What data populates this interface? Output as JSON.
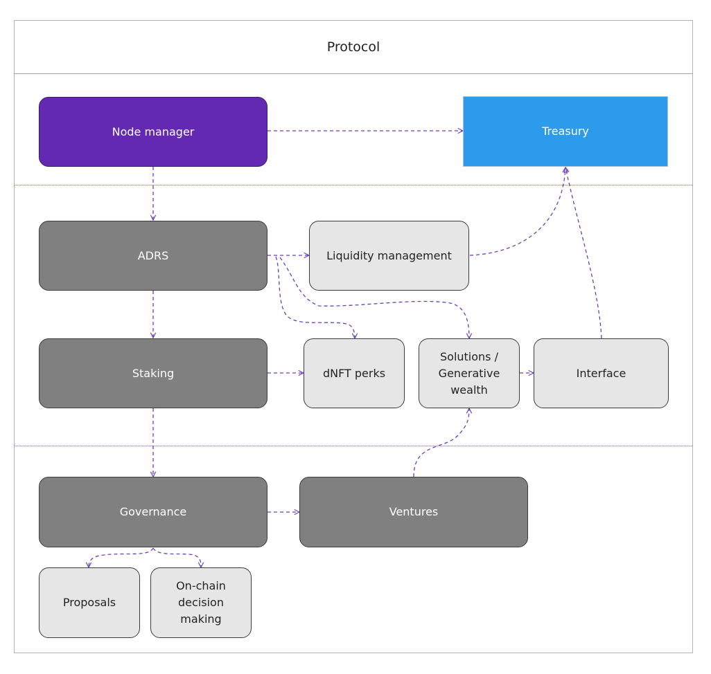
{
  "diagram": {
    "title": "Protocol",
    "colors": {
      "primary_node": "#6429b2",
      "treasury_node": "#2d9bec",
      "core_node": "#808080",
      "secondary_node": "#e6e6e6",
      "edge": "#6a3fb8",
      "lane_separator": "#7a5cc4"
    },
    "nodes": {
      "node_manager": "Node manager",
      "treasury": "Treasury",
      "adrs": "ADRS",
      "liquidity_management": "Liquidity management",
      "staking": "Staking",
      "dnft_perks": "dNFT perks",
      "solutions": "Solutions / Generative wealth",
      "interface": "Interface",
      "governance": "Governance",
      "ventures": "Ventures",
      "proposals": "Proposals",
      "on_chain": "On-chain decision making"
    },
    "edges": [
      {
        "from": "Node manager",
        "to": "Treasury"
      },
      {
        "from": "Node manager",
        "to": "ADRS"
      },
      {
        "from": "ADRS",
        "to": "Liquidity management"
      },
      {
        "from": "ADRS",
        "to": "dNFT perks"
      },
      {
        "from": "ADRS",
        "to": "Solutions / Generative wealth"
      },
      {
        "from": "ADRS",
        "to": "Staking"
      },
      {
        "from": "Liquidity management",
        "to": "Treasury"
      },
      {
        "from": "Interface",
        "to": "Treasury"
      },
      {
        "from": "Staking",
        "to": "dNFT perks"
      },
      {
        "from": "Staking",
        "to": "Governance"
      },
      {
        "from": "Solutions / Generative wealth",
        "to": "Interface"
      },
      {
        "from": "Governance",
        "to": "Ventures"
      },
      {
        "from": "Ventures",
        "to": "Solutions / Generative wealth"
      },
      {
        "from": "Governance",
        "to": "Proposals"
      },
      {
        "from": "Governance",
        "to": "On-chain decision making"
      }
    ]
  }
}
